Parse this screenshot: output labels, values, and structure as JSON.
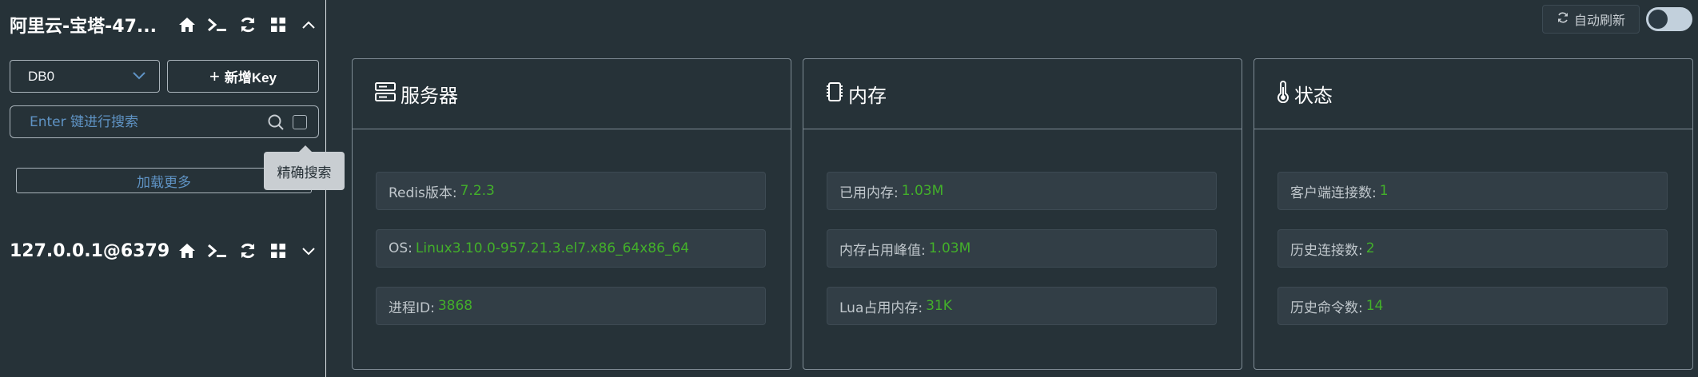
{
  "sidebar": {
    "connections": [
      {
        "name": "阿里云-宝塔-47...",
        "expanded": true
      },
      {
        "name": "127.0.0.1@6379",
        "expanded": false
      }
    ],
    "db_select": {
      "value": "DB0"
    },
    "new_key_label": "新增Key",
    "search": {
      "placeholder": "Enter 键进行搜索"
    },
    "exact_search_tooltip": "精确搜索",
    "load_more": "加载更多"
  },
  "topbar": {
    "auto_refresh_label": "自动刷新",
    "auto_refresh_on": false
  },
  "cards": [
    {
      "title": "服务器",
      "icon": "server-icon",
      "rows": [
        {
          "label": "Redis版本:",
          "value": "7.2.3"
        },
        {
          "label": "OS:",
          "value": "Linux3.10.0-957.21.3.el7.x86_64x86_64"
        },
        {
          "label": "进程ID:",
          "value": "3868"
        }
      ]
    },
    {
      "title": "内存",
      "icon": "memory-chip-icon",
      "rows": [
        {
          "label": "已用内存:",
          "value": "1.03M"
        },
        {
          "label": "内存占用峰值:",
          "value": "1.03M"
        },
        {
          "label": "Lua占用内存:",
          "value": "31K"
        }
      ]
    },
    {
      "title": "状态",
      "icon": "thermometer-icon",
      "rows": [
        {
          "label": "客户端连接数:",
          "value": "1"
        },
        {
          "label": "历史连接数:",
          "value": "2"
        },
        {
          "label": "历史命令数:",
          "value": "14"
        }
      ]
    }
  ],
  "colors": {
    "background": "#263238",
    "value_green": "#43b02a",
    "placeholder_blue": "#5f93c4",
    "border": "#7e8b94"
  }
}
